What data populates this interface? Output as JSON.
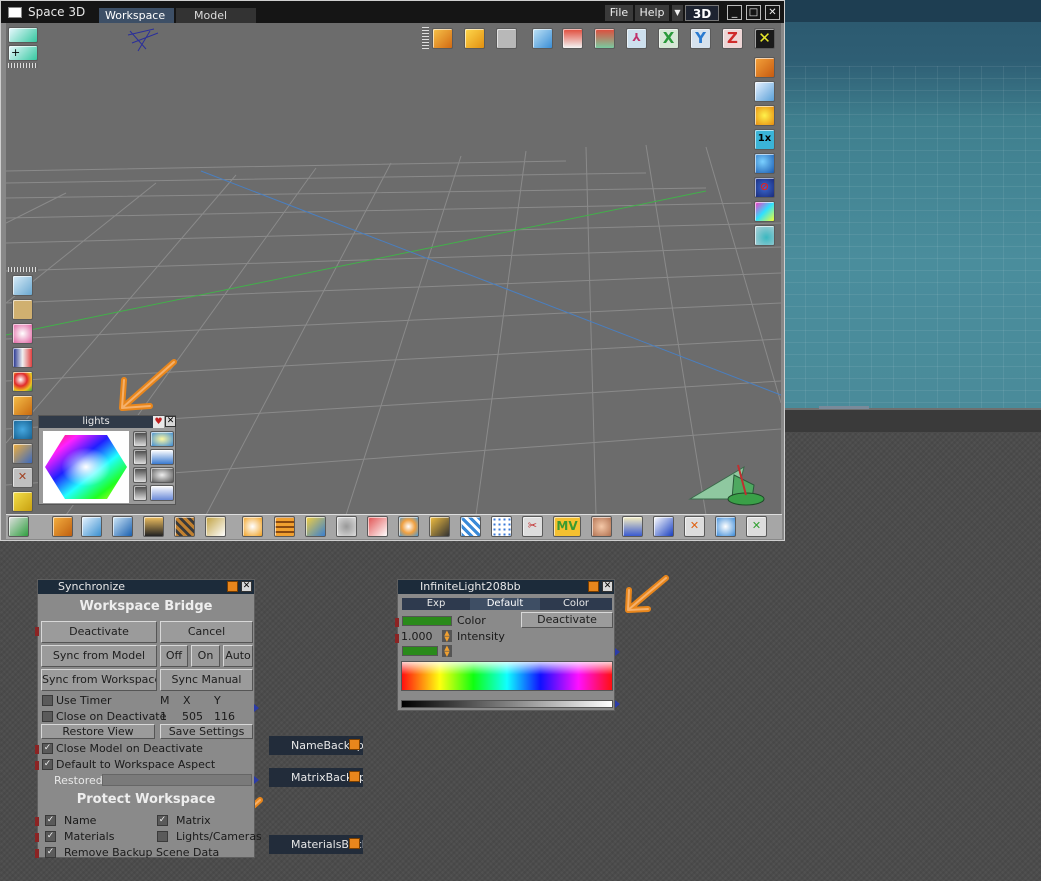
{
  "app": {
    "title": "Space 3D",
    "view_badge": "3D"
  },
  "tabs": {
    "workspace": "Workspace",
    "model": "Model"
  },
  "menu": {
    "file": "File",
    "help": "Help"
  },
  "window_controls": {
    "minimize": "_",
    "maximize": "□",
    "close": "✕"
  },
  "toolbars": {
    "top_icons": [
      "cube-orange-icon",
      "cube-yellow-icon",
      "square-frame-icon",
      "cone-light-icon",
      "house-icon",
      "house-frame-icon",
      "axis-tripod-icon",
      "x-axis-icon",
      "y-axis-icon",
      "z-axis-icon",
      "crosshair-icon"
    ],
    "top_axis_labels": {
      "x": "X",
      "y": "Y",
      "z": "Z"
    },
    "right_icons": [
      "cube-stack-icon",
      "monitor-globe-icon",
      "arrows-star-icon",
      "scale-1x-icon",
      "spheres-icon",
      "no-globe-icon",
      "gradient-square-icon",
      "sphere-cube-icon"
    ],
    "right_scale_label": "1x",
    "left_icons": [
      "mesh-icon",
      "curve-icon",
      "molecule-icon",
      "spectrum-triangle-icon",
      "color-sphere-icon",
      "box-open-icon",
      "shapes-icon",
      "blocks-icon",
      "tools-icon",
      "pencil-icon"
    ],
    "bottom_icons": [
      "recycle-icon",
      "cube-icon",
      "cone-icon",
      "spotlight-icon",
      "layers-icon",
      "grid-cube-icon",
      "shell-icon",
      "spiral-sphere-icon",
      "lattice-icon",
      "fold-icon",
      "loop-icon",
      "ribbon-icon",
      "palette-icon",
      "torch-icon",
      "checker-icon",
      "dots-icon",
      "scissors-icon",
      "mv-letters-icon",
      "face-icon",
      "paint-hand-icon",
      "paint-bucket-icon",
      "cross-tools-icon",
      "swirl-icon",
      "grid-arrow-icon"
    ],
    "bottom_mv_label": "MV"
  },
  "lights_panel": {
    "title": "lights"
  },
  "synchronize": {
    "title": "Synchronize",
    "header": "Workspace Bridge",
    "deactivate": "Deactivate",
    "cancel": "Cancel",
    "sync_from_model": "Sync from Model",
    "off": "Off",
    "on": "On",
    "auto": "Auto",
    "sync_from_workspace": "Sync from Workspace",
    "sync_manual": "Sync Manual",
    "use_timer": "Use Timer",
    "col_m": "M",
    "col_x": "X",
    "col_y": "Y",
    "close_on_deactivate": "Close on Deactivate",
    "val_m": "1",
    "val_x": "505",
    "val_y": "116",
    "restore_view": "Restore View",
    "save_settings": "Save Settings",
    "close_model_on_deactivate": "Close Model on Deactivate",
    "default_to_workspace_aspect": "Default to Workspace Aspect",
    "restored": "Restored",
    "protect_header": "Protect Workspace",
    "name": "Name",
    "matrix": "Matrix",
    "materials": "Materials",
    "lights_cameras": "Lights/Cameras",
    "remove_backup": "Remove Backup Scene Data",
    "checks": {
      "use_timer": false,
      "close_on_deactivate": false,
      "close_model": true,
      "default_aspect": true,
      "name": true,
      "matrix": true,
      "materials": true,
      "lights_cameras": false,
      "remove_backup": true
    }
  },
  "backups": {
    "name": "NameBackup",
    "matrix": "MatrixBackup",
    "materials": "MaterialsBackup"
  },
  "infinite_light": {
    "title": "InfiniteLight208bb",
    "tab_exp": "Exp",
    "tab_default": "Default",
    "tab_color": "Color",
    "color_label": "Color",
    "deactivate": "Deactivate",
    "intensity_value": "1.000",
    "intensity_label": "Intensity"
  },
  "colors": {
    "accent_orange": "#e8861c",
    "title_bar": "#151515",
    "panel_title": "#1c2b3a",
    "grid_green": "#42b04a",
    "grid_blue": "#4a7fc0"
  }
}
